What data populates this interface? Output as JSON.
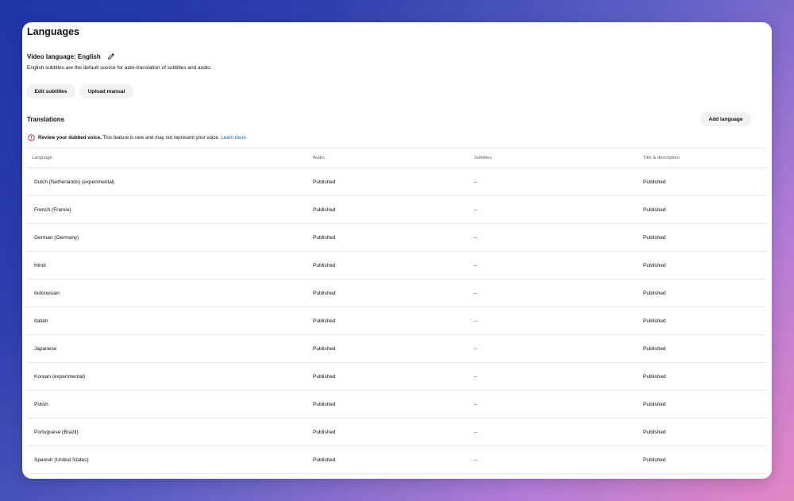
{
  "page": {
    "title": "Languages"
  },
  "video_language": {
    "label": "Video language: English",
    "description": "English subtitles are the default source for auto-translation of subtitles and audio.",
    "edit_icon": "pencil-icon"
  },
  "actions": {
    "edit_subtitles": "Edit subtitles",
    "upload_manual": "Upload manual",
    "add_language": "Add language"
  },
  "translations": {
    "title": "Translations",
    "warning": {
      "icon": "error-circle-icon",
      "icon_color": "#cc0000",
      "bold_text": "Review your dubbed voice.",
      "text": " This feature is new and may not represent your voice. ",
      "link": "Learn more",
      "link_color": "#065fd4"
    },
    "columns": [
      "Language",
      "Audio",
      "Subtitles",
      "Title & description"
    ],
    "rows": [
      {
        "language": "Dutch (Netherlands) (experimental)",
        "audio": "Published",
        "subtitles": "–",
        "title_description": "Published"
      },
      {
        "language": "French (France)",
        "audio": "Published",
        "subtitles": "–",
        "title_description": "Published"
      },
      {
        "language": "German (Germany)",
        "audio": "Published",
        "subtitles": "–",
        "title_description": "Published"
      },
      {
        "language": "Hindi",
        "audio": "Published",
        "subtitles": "–",
        "title_description": "Published"
      },
      {
        "language": "Indonesian",
        "audio": "Published",
        "subtitles": "–",
        "title_description": "Published"
      },
      {
        "language": "Italian",
        "audio": "Published",
        "subtitles": "–",
        "title_description": "Published"
      },
      {
        "language": "Japanese",
        "audio": "Published",
        "subtitles": "–",
        "title_description": "Published"
      },
      {
        "language": "Korean (experimental)",
        "audio": "Published",
        "subtitles": "–",
        "title_description": "Published"
      },
      {
        "language": "Polish",
        "audio": "Published",
        "subtitles": "–",
        "title_description": "Published"
      },
      {
        "language": "Portuguese (Brazil)",
        "audio": "Published",
        "subtitles": "–",
        "title_description": "Published"
      },
      {
        "language": "Spanish (United States)",
        "audio": "Published",
        "subtitles": "–",
        "title_description": "Published"
      }
    ]
  }
}
